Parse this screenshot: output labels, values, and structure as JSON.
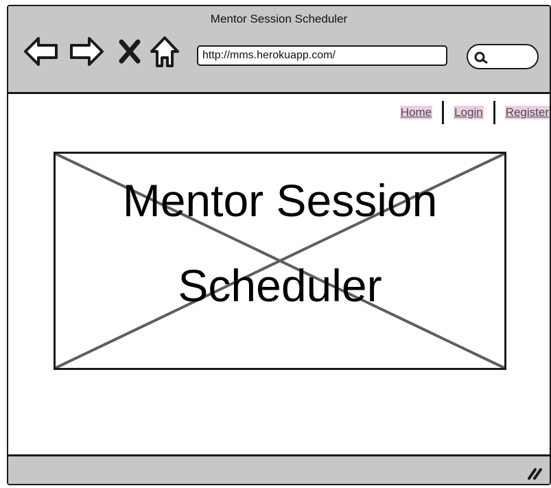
{
  "window": {
    "title": "Mentor Session Scheduler"
  },
  "toolbar": {
    "back_icon": "arrow-left-icon",
    "forward_icon": "arrow-right-icon",
    "stop_icon": "close-icon",
    "home_icon": "home-icon",
    "url": "http://mms.herokuapp.com/",
    "search_icon": "search-icon"
  },
  "nav": {
    "links": [
      {
        "label": "Home"
      },
      {
        "label": "Login"
      },
      {
        "label": "Register"
      }
    ]
  },
  "hero": {
    "title": "Mentor Session\nScheduler",
    "image_placeholder": "image-placeholder-icon"
  },
  "colors": {
    "chrome": "#c7c7c7",
    "link_highlight": "#ebcfe3",
    "link_text": "#4b4b4b",
    "outline": "#1a1a1a"
  }
}
